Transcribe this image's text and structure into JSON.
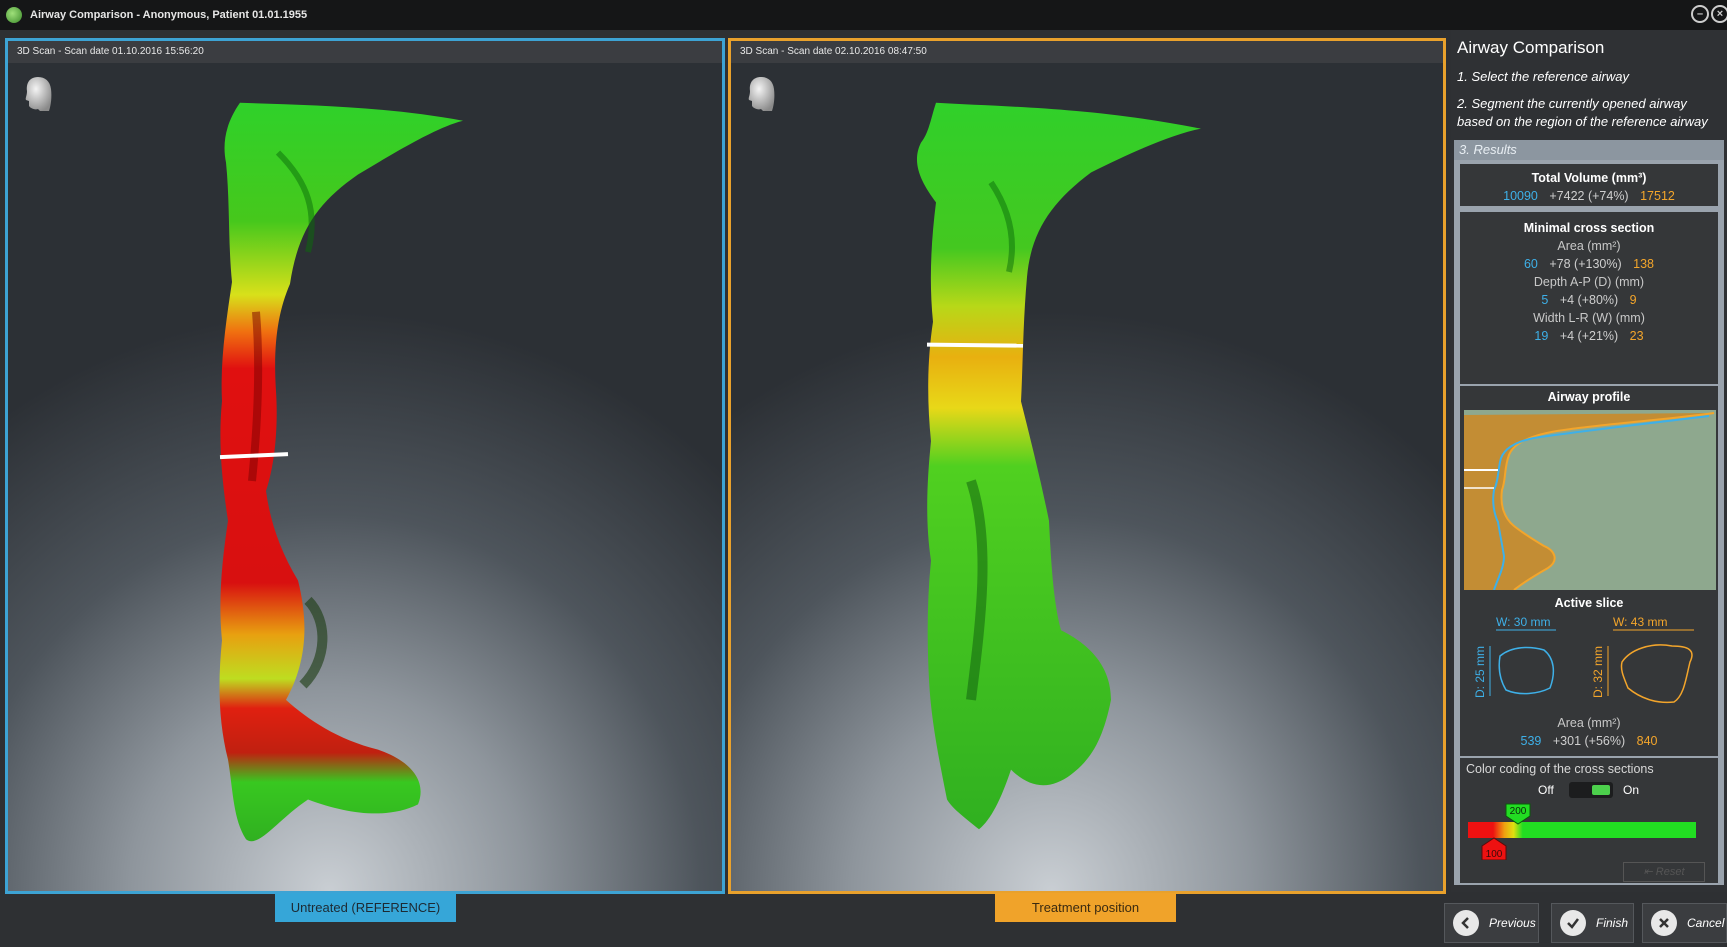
{
  "window": {
    "title": "Airway Comparison - Anonymous, Patient 01.01.1955"
  },
  "viewports": {
    "reference": {
      "header": "3D Scan - Scan date 01.10.2016 15:56:20",
      "label": "Untreated (REFERENCE)",
      "border_color": "#3da3d4"
    },
    "treatment": {
      "header": "3D Scan - Scan date 02.10.2016 08:47:50",
      "label": "Treatment position",
      "border_color": "#e9a12c"
    }
  },
  "panel": {
    "title": "Airway Comparison",
    "step1": "1. Select the reference airway",
    "step2": "2. Segment the currently opened airway based on the region of the reference airway",
    "results_title": "3. Results",
    "total_volume": {
      "label": "Total Volume (mm³)",
      "ref": "10090",
      "diff": "+7422 (+74%)",
      "treat": "17512"
    },
    "min_cross_section": {
      "title": "Minimal cross section",
      "area_label": "Area (mm²)",
      "area_ref": "60",
      "area_diff": "+78 (+130%)",
      "area_treat": "138",
      "depth_label": "Depth A-P (D) (mm)",
      "depth_ref": "5",
      "depth_diff": "+4 (+80%)",
      "depth_treat": "9",
      "width_label": "Width L-R (W) (mm)",
      "width_ref": "19",
      "width_diff": "+4 (+21%)",
      "width_treat": "23"
    },
    "airway_profile": {
      "title": "Airway profile"
    },
    "active_slice": {
      "title": "Active slice",
      "ref_width": "W: 30 mm",
      "ref_depth": "D: 25 mm",
      "treat_width": "W: 43 mm",
      "treat_depth": "D: 32 mm",
      "area_label": "Area (mm²)",
      "area_ref": "539",
      "area_diff": "+301 (+56%)",
      "area_treat": "840"
    },
    "color_coding": {
      "title": "Color coding of the cross sections",
      "off_label": "Off",
      "on_label": "On",
      "enabled": true,
      "low_marker": "100",
      "high_marker": "200",
      "reset_label": "Reset"
    }
  },
  "buttons": {
    "previous": "Previous",
    "finish": "Finish",
    "cancel": "Cancel"
  },
  "colors": {
    "reference": "#3eb0e8",
    "treatment": "#f3a52b",
    "good": "#22dd22",
    "bad": "#ee1111"
  }
}
